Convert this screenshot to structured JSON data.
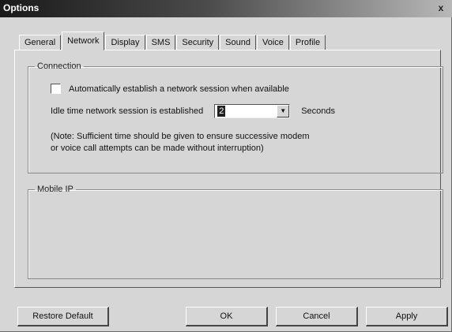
{
  "window": {
    "title": "Options",
    "close_glyph": "x"
  },
  "tabs": [
    {
      "label": "General",
      "active": false
    },
    {
      "label": "Network",
      "active": true
    },
    {
      "label": "Display",
      "active": false
    },
    {
      "label": "SMS",
      "active": false
    },
    {
      "label": "Security",
      "active": false
    },
    {
      "label": "Sound",
      "active": false
    },
    {
      "label": "Voice",
      "active": false
    },
    {
      "label": "Profile",
      "active": false
    }
  ],
  "connection": {
    "legend": "Connection",
    "auto_checkbox_label": "Automatically establish a network session when available",
    "auto_checked": false,
    "idle_label": "Idle time network session is established",
    "idle_value": "2",
    "idle_unit": "Seconds",
    "note_line1": "(Note: Sufficient time should be given to ensure successive modem",
    "note_line2": "or voice call attempts can be made without interruption)"
  },
  "mobile_ip": {
    "legend": "Mobile IP"
  },
  "buttons": {
    "restore": "Restore Default",
    "ok": "OK",
    "cancel": "Cancel",
    "apply": "Apply"
  },
  "icons": {
    "dropdown": "chevron-down-icon",
    "close": "close-icon"
  }
}
